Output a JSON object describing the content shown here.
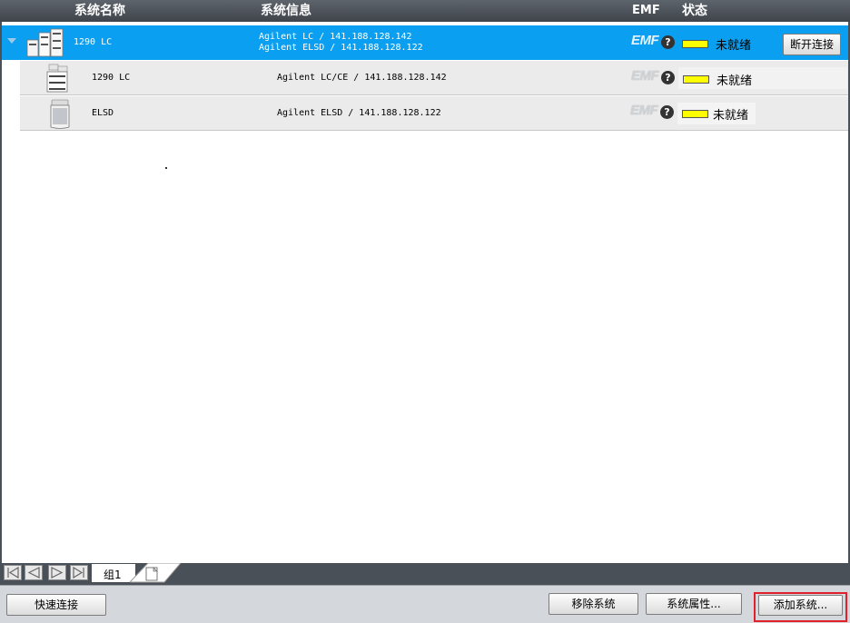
{
  "header": {
    "col_name": "系统名称",
    "col_info": "系统信息",
    "col_emf": "EMF",
    "col_status": "状态"
  },
  "systems": {
    "parent": {
      "name": "1290 LC",
      "info_line1": "Agilent LC / 141.188.128.142",
      "info_line2": "Agilent ELSD / 141.188.128.122",
      "emf": "EMF",
      "help": "?",
      "status": "未就绪",
      "disconnect_label": "断开连接"
    },
    "children": [
      {
        "name": "1290 LC",
        "info": "Agilent LC/CE / 141.188.128.142",
        "emf": "EMF",
        "help": "?",
        "status": "未就绪"
      },
      {
        "name": "ELSD",
        "info": "Agilent ELSD / 141.188.128.122",
        "emf": "EMF",
        "help": "?",
        "status": "未就绪"
      }
    ],
    "status_color": "#ffff00",
    "selected_color": "#0a9ff0"
  },
  "tabs": {
    "group1": "组1"
  },
  "bottom": {
    "quick_connect": "快速连接",
    "remove_system": "移除系统",
    "system_properties": "系统属性...",
    "add_system": "添加系统..."
  },
  "icons": {
    "expander": "chevron-down-icon",
    "help": "help-icon",
    "first": "first-page-icon",
    "prev": "prev-page-icon",
    "next": "next-page-icon",
    "last": "last-page-icon",
    "new_tab": "new-tab-icon"
  }
}
